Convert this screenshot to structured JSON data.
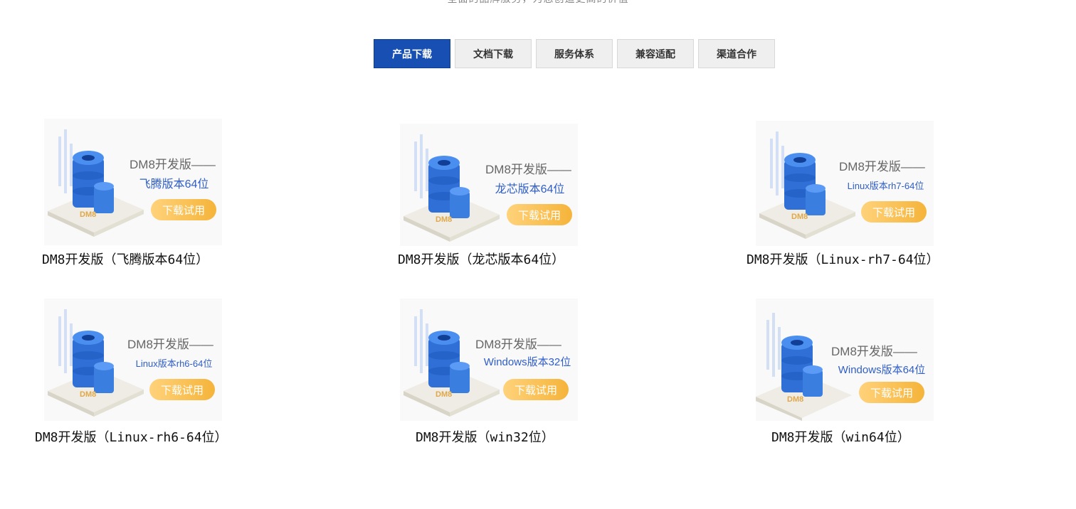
{
  "header": {
    "subtitle": "全面的品牌服务，为您创造更高的价值"
  },
  "tabs": [
    {
      "label": "产品下载"
    },
    {
      "label": "文档下载"
    },
    {
      "label": "服务体系"
    },
    {
      "label": "兼容适配"
    },
    {
      "label": "渠道合作"
    }
  ],
  "products": [
    {
      "thumb_title": "DM8开发版——",
      "thumb_sub": "飞腾版本64位",
      "button": "下载试用",
      "caption": "DM8开发版（飞腾版本64位）"
    },
    {
      "thumb_title": "DM8开发版——",
      "thumb_sub": "龙芯版本64位",
      "button": "下载试用",
      "caption": "DM8开发版（龙芯版本64位）"
    },
    {
      "thumb_title": "DM8开发版——",
      "thumb_sub": "Linux版本rh7-64位",
      "button": "下载试用",
      "caption": "DM8开发版（Linux-rh7-64位）"
    },
    {
      "thumb_title": "DM8开发版——",
      "thumb_sub": "Linux版本rh6-64位",
      "button": "下载试用",
      "caption": "DM8开发版（Linux-rh6-64位）"
    },
    {
      "thumb_title": "DM8开发版——",
      "thumb_sub": "Windows版本32位",
      "button": "下载试用",
      "caption": "DM8开发版（win32位）"
    },
    {
      "thumb_title": "DM8开发版——",
      "thumb_sub": "Windows版本64位",
      "button": "下载试用",
      "caption": "DM8开发版（win64位）"
    }
  ],
  "colors": {
    "active_tab": "#1750b2",
    "tab_bg": "#efefef",
    "thumb_accent": "#2f5ec8",
    "button_orange": "#f5b43a"
  }
}
